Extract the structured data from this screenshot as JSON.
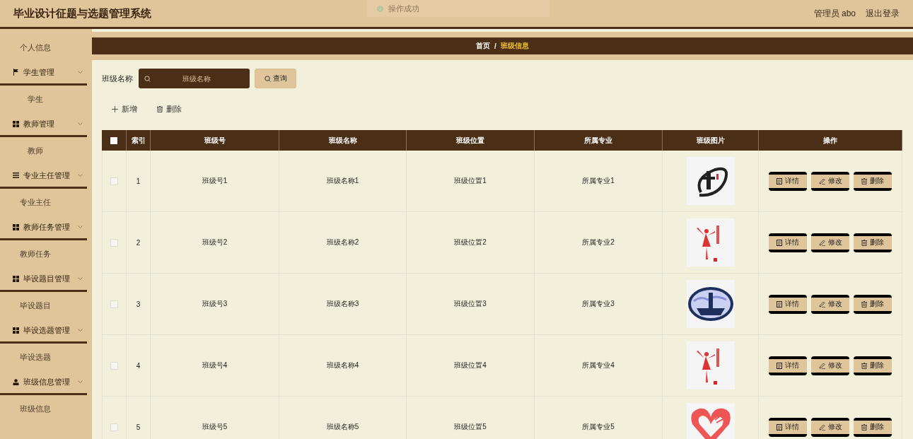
{
  "header": {
    "title": "毕业设计征题与选题管理系统",
    "user": "管理员 abo",
    "logout": "退出登录"
  },
  "toast": {
    "message": "操作成功"
  },
  "sidebar": {
    "items": [
      {
        "label": "个人信息"
      },
      {
        "label": "学生管理",
        "expanded": true,
        "children": [
          {
            "label": "学生"
          }
        ]
      },
      {
        "label": "教师管理",
        "expanded": true,
        "children": [
          {
            "label": "教师"
          }
        ]
      },
      {
        "label": "专业主任管理",
        "expanded": true,
        "children": [
          {
            "label": "专业主任"
          }
        ]
      },
      {
        "label": "教师任务管理",
        "expanded": true,
        "children": [
          {
            "label": "教师任务"
          }
        ]
      },
      {
        "label": "毕设题目管理",
        "expanded": true,
        "children": [
          {
            "label": "毕设题目"
          }
        ]
      },
      {
        "label": "毕设选题管理",
        "expanded": true,
        "children": [
          {
            "label": "毕设选题"
          }
        ]
      },
      {
        "label": "班级信息管理",
        "expanded": true,
        "children": [
          {
            "label": "班级信息"
          }
        ]
      }
    ]
  },
  "breadcrumb": [
    {
      "label": "首页",
      "selected": false
    },
    {
      "label": "班级信息",
      "selected": true
    }
  ],
  "breadcrumb_separator": "/",
  "search": {
    "label": "班级名称",
    "placeholder": "班级名称",
    "button": "查询"
  },
  "toolbar": [
    {
      "kind": "add",
      "label": "新增"
    },
    {
      "kind": "delete",
      "label": "删除"
    }
  ],
  "table": {
    "select_all_checked": false,
    "columns": [
      "索引",
      "班级号",
      "班级名称",
      "班级位置",
      "所属专业",
      "班级图片",
      "操作"
    ],
    "rows": [
      {
        "checked": false,
        "index": "1",
        "number": "班级号1",
        "name": "班级名称1",
        "location": "班级位置1",
        "major": "所属专业1",
        "actions": [
          {
            "kind": "detail",
            "label": "详情"
          },
          {
            "kind": "edit",
            "label": "修改"
          },
          {
            "kind": "delete",
            "label": "删除"
          }
        ]
      },
      {
        "checked": false,
        "index": "2",
        "number": "班级号2",
        "name": "班级名称2",
        "location": "班级位置2",
        "major": "所属专业2",
        "actions": [
          {
            "kind": "detail",
            "label": "详情"
          },
          {
            "kind": "edit",
            "label": "修改"
          },
          {
            "kind": "delete",
            "label": "删除"
          }
        ]
      },
      {
        "checked": false,
        "index": "3",
        "number": "班级号3",
        "name": "班级名称3",
        "location": "班级位置3",
        "major": "所属专业3",
        "actions": [
          {
            "kind": "detail",
            "label": "详情"
          },
          {
            "kind": "edit",
            "label": "修改"
          },
          {
            "kind": "delete",
            "label": "删除"
          }
        ]
      },
      {
        "checked": false,
        "index": "4",
        "number": "班级号4",
        "name": "班级名称4",
        "location": "班级位置4",
        "major": "所属专业4",
        "actions": [
          {
            "kind": "detail",
            "label": "详情"
          },
          {
            "kind": "edit",
            "label": "修改"
          },
          {
            "kind": "delete",
            "label": "删除"
          }
        ]
      },
      {
        "checked": false,
        "index": "5",
        "number": "班级号5",
        "name": "班级名称5",
        "location": "班级位置5",
        "major": "所属专业5",
        "actions": [
          {
            "kind": "detail",
            "label": "详情"
          },
          {
            "kind": "edit",
            "label": "修改"
          },
          {
            "kind": "delete",
            "label": "删除"
          }
        ]
      }
    ]
  }
}
